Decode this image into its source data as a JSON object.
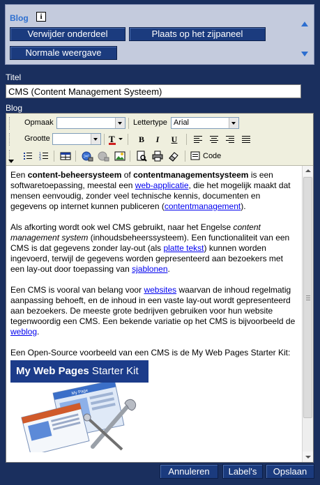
{
  "panel": {
    "title": "Blog",
    "info_glyph": "i",
    "buttons": {
      "remove": "Verwijder onderdeel",
      "side_panel": "Plaats op het zijpaneel",
      "normal_view": "Normale weergave"
    },
    "icons": {
      "up": "arrow-up-icon",
      "down": "arrow-down-icon"
    }
  },
  "fields": {
    "title_label": "Titel",
    "title_value": "CMS (Content Management Systeem)",
    "blog_label": "Blog"
  },
  "toolbar": {
    "format_label": "Opmaak",
    "format_value": "",
    "font_label": "Lettertype",
    "font_value": "Arial",
    "size_label": "Grootte",
    "size_value": "",
    "bold": "B",
    "italic": "I",
    "underline": "U",
    "code_label": "Code"
  },
  "content": {
    "p1": {
      "a": "Een ",
      "b": "content-beheersysteem",
      "c": " of ",
      "d": "contentmanagementsysteem",
      "e": " is een softwaretoepassing, meestal een ",
      "link1": "web-applicatie",
      "f": ", die het mogelijk maakt dat mensen eenvoudig, zonder veel technische kennis, documenten en gegevens op internet kunnen publiceren (",
      "link2": "contentmanagement",
      "g": ")."
    },
    "p2": {
      "a": "Als afkorting wordt ook wel CMS gebruikt, naar het Engelse ",
      "em": "content management system",
      "b": " (inhoudsbeheerssysteem). Een functionaliteit van een CMS is dat gegevens zonder lay-out (als ",
      "link1": "platte tekst",
      "c": ") kunnen worden ingevoerd, terwijl de gegevens worden gepresenteerd aan bezoekers met een lay-out door toepassing van ",
      "link2": "sjablonen",
      "d": "."
    },
    "p3": {
      "a": "Een CMS is vooral van belang voor ",
      "link1": "websites",
      "b": " waarvan de inhoud regelmatig aanpassing behoeft, en de inhoud in een vaste lay-out wordt gepresenteerd aan bezoekers. De meeste grote bedrijven gebruiken voor hun website tegenwoordig een CMS. Een bekende variatie op het CMS is bijvoorbeeld de ",
      "link2": "weblog",
      "c": "."
    },
    "p4": "Een Open-Source voorbeeld van een CMS is de My Web Pages Starter Kit:",
    "banner_bold": "My Web Pages",
    "banner_rest": " Starter Kit",
    "thumb_label": "My Page"
  },
  "footer": {
    "cancel": "Annuleren",
    "labels": "Label's",
    "save": "Opslaan"
  },
  "colors": {
    "background": "#1a2f5e",
    "button": "#1b3b7e",
    "panel": "#c4cbdd",
    "accent": "#2d6fd0"
  }
}
